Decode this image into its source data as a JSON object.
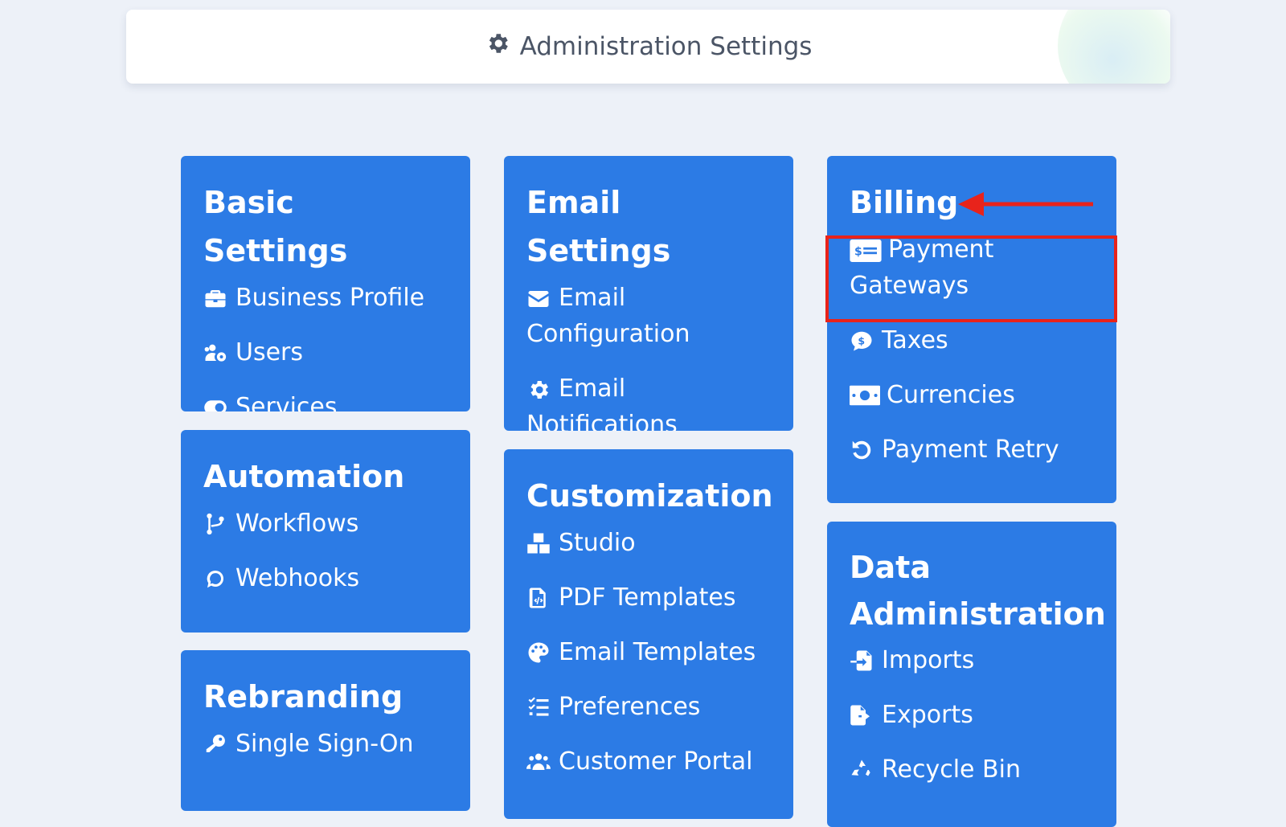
{
  "header": {
    "title": "Administration Settings",
    "icon": "gear-icon"
  },
  "cards": {
    "basic_settings": {
      "title": "Basic Settings",
      "items": [
        {
          "label": "Business Profile",
          "icon": "briefcase-icon"
        },
        {
          "label": "Users",
          "icon": "users-cog-icon"
        },
        {
          "label": "Services",
          "icon": "toggle-icon"
        }
      ]
    },
    "automation": {
      "title": "Automation",
      "items": [
        {
          "label": "Workflows",
          "icon": "branch-icon"
        },
        {
          "label": "Webhooks",
          "icon": "webhook-icon"
        }
      ]
    },
    "rebranding": {
      "title": "Rebranding",
      "items": [
        {
          "label": "Single Sign-On",
          "icon": "key-icon"
        }
      ]
    },
    "email_settings": {
      "title": "Email Settings",
      "items": [
        {
          "label": "Email Configuration",
          "icon": "envelope-icon"
        },
        {
          "label": "Email Notifications",
          "icon": "gear-icon"
        }
      ]
    },
    "customization": {
      "title": "Customization",
      "items": [
        {
          "label": "Studio",
          "icon": "boxes-icon"
        },
        {
          "label": "PDF Templates",
          "icon": "file-code-icon"
        },
        {
          "label": "Email Templates",
          "icon": "palette-icon"
        },
        {
          "label": "Preferences",
          "icon": "checklist-icon"
        },
        {
          "label": "Customer Portal",
          "icon": "users-icon"
        }
      ]
    },
    "billing": {
      "title": "Billing",
      "items": [
        {
          "label": "Payment Gateways",
          "icon": "money-check-icon"
        },
        {
          "label": "Taxes",
          "icon": "dollar-bubble-icon"
        },
        {
          "label": "Currencies",
          "icon": "money-bill-icon"
        },
        {
          "label": "Payment Retry",
          "icon": "retry-icon"
        }
      ]
    },
    "data_administration": {
      "title": "Data Administration",
      "items": [
        {
          "label": "Imports",
          "icon": "file-import-icon"
        },
        {
          "label": "Exports",
          "icon": "file-export-icon"
        },
        {
          "label": "Recycle Bin",
          "icon": "recycle-icon"
        }
      ]
    }
  },
  "annotation": {
    "highlight_color": "#e8231b"
  },
  "colors": {
    "card_bg": "#2c7be5",
    "page_bg": "#edf1f8"
  }
}
